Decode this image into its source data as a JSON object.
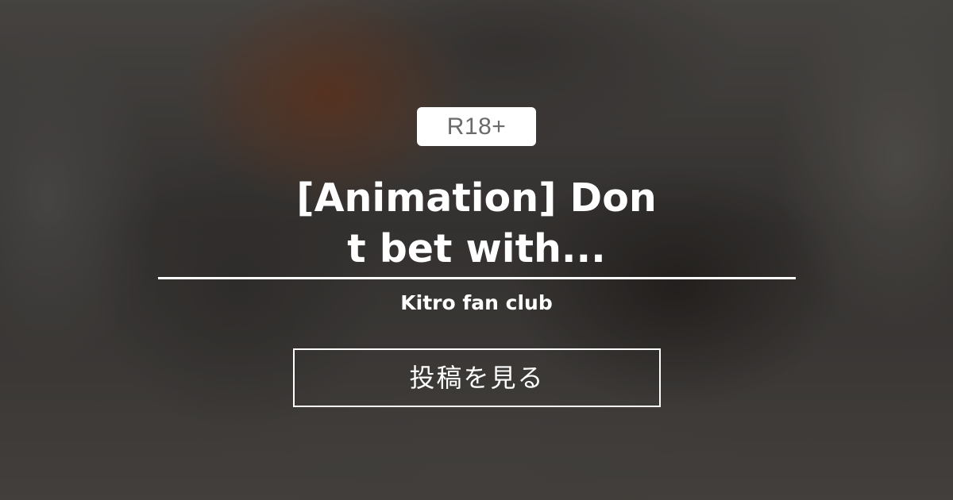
{
  "badge": {
    "label": "R18+"
  },
  "post": {
    "title": "[Animation] Don\nt bet with...",
    "creator": "Kitro fan club"
  },
  "cta": {
    "label": "投稿を見る"
  },
  "colors": {
    "text": "#ffffff",
    "badge_bg": "#ffffff",
    "badge_text": "#6b6b6b",
    "background": "#4a4846"
  }
}
